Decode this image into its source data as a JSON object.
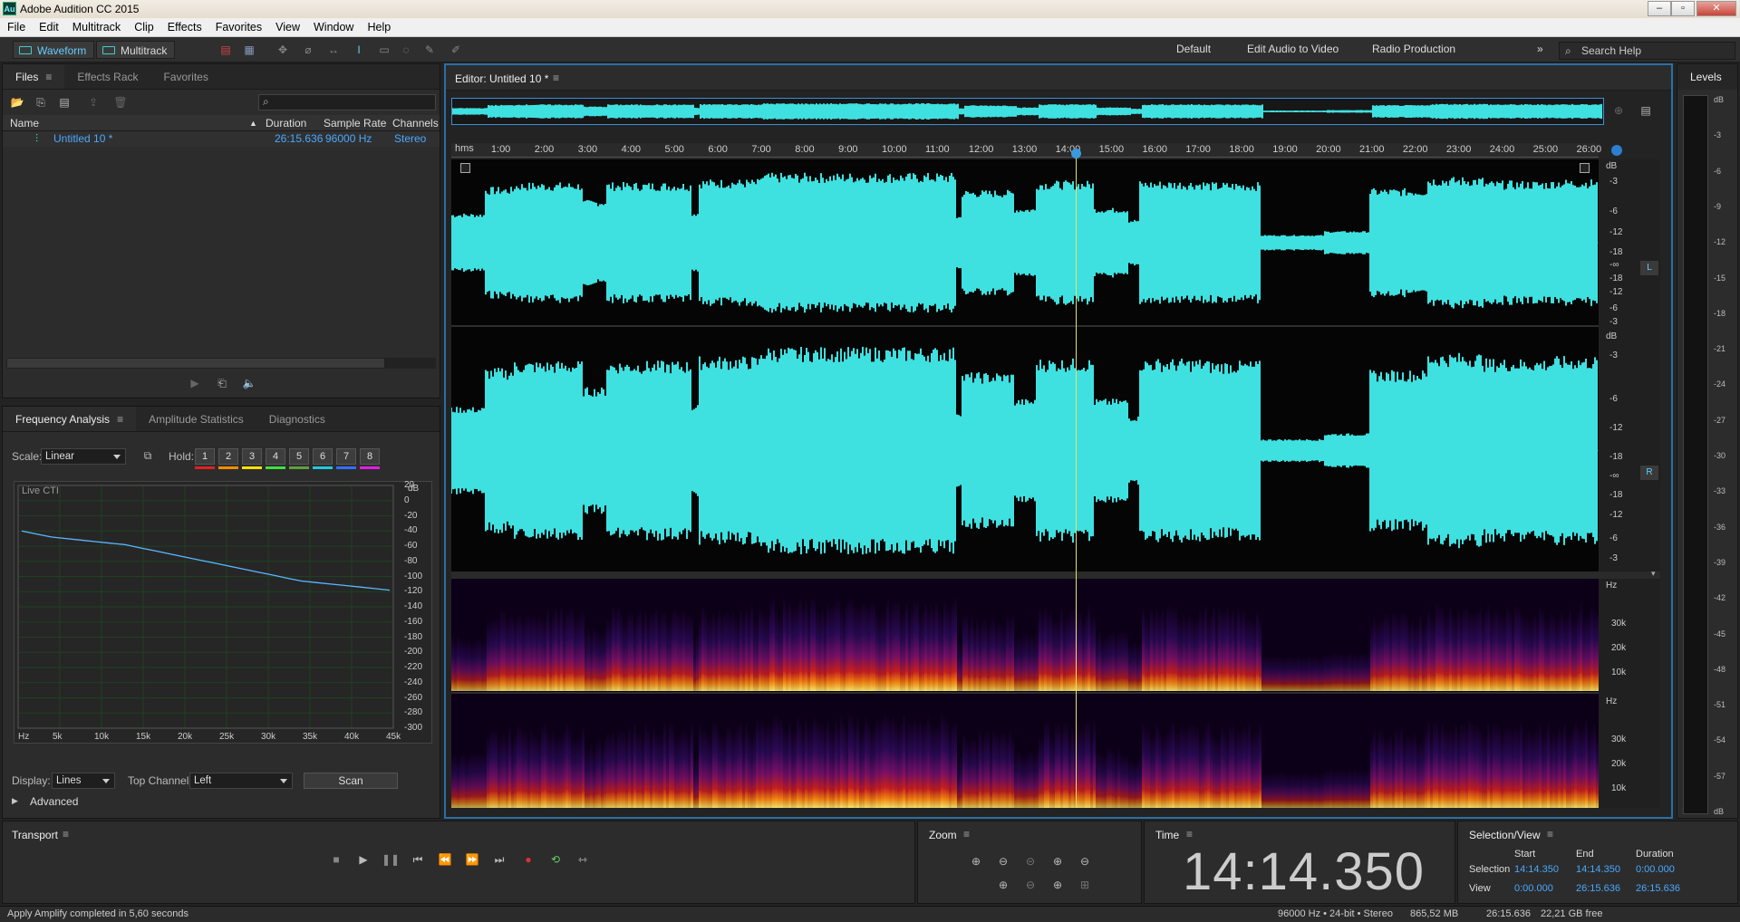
{
  "app": {
    "title": "Adobe Audition CC 2015",
    "icon": "Au"
  },
  "menu": [
    "File",
    "Edit",
    "Multitrack",
    "Clip",
    "Effects",
    "Favorites",
    "View",
    "Window",
    "Help"
  ],
  "toolbar": {
    "waveform": "Waveform",
    "multitrack": "Multitrack"
  },
  "workspaces": [
    "Default",
    "Edit Audio to Video",
    "Radio Production"
  ],
  "search": {
    "placeholder": "Search Help"
  },
  "files_panel": {
    "tabs": [
      "Files",
      "Effects Rack",
      "Favorites"
    ],
    "columns": [
      "Name",
      "Duration",
      "Sample Rate",
      "Channels"
    ],
    "rows": [
      {
        "name": "Untitled 10 *",
        "duration": "26:15.636",
        "sample_rate": "96000 Hz",
        "channels": "Stereo"
      }
    ]
  },
  "freq_panel": {
    "tabs": [
      "Frequency Analysis",
      "Amplitude Statistics",
      "Diagnostics"
    ],
    "scale_label": "Scale:",
    "scale_value": "Linear",
    "hold_label": "Hold:",
    "hold": [
      "1",
      "2",
      "3",
      "4",
      "5",
      "6",
      "7",
      "8"
    ],
    "hold_colors": [
      "#e02020",
      "#ff8c00",
      "#ffe000",
      "#40e040",
      "#60a040",
      "#20c8e0",
      "#3070ff",
      "#e020e0"
    ],
    "live": "Live CTI",
    "db_unit": "dB",
    "db_ticks": [
      "20",
      "0",
      "-20",
      "-40",
      "-60",
      "-80",
      "-100",
      "-120",
      "-140",
      "-160",
      "-180",
      "-200",
      "-220",
      "-240",
      "-260",
      "-280",
      "-300"
    ],
    "hz_ticks": [
      "Hz",
      "5k",
      "10k",
      "15k",
      "20k",
      "25k",
      "30k",
      "35k",
      "40k",
      "45k"
    ],
    "display_label": "Display:",
    "display_value": "Lines",
    "top_channel_label": "Top Channel:",
    "top_channel_value": "Left",
    "scan": "Scan",
    "advanced": "Advanced",
    "curve_db": [
      -40,
      -44,
      -48,
      -50,
      -52,
      -54,
      -56,
      -58,
      -62,
      -66,
      -70,
      -74,
      -78,
      -82,
      -86,
      -90,
      -94,
      -98,
      -102,
      -106,
      -108,
      -110,
      -112,
      -114,
      -116,
      -118
    ]
  },
  "editor": {
    "title": "Editor: Untitled 10 *",
    "ruler_unit": "hms",
    "ruler": [
      "1:00",
      "2:00",
      "3:00",
      "4:00",
      "5:00",
      "6:00",
      "7:00",
      "8:00",
      "9:00",
      "10:00",
      "11:00",
      "12:00",
      "13:00",
      "14:00",
      "15:00",
      "16:00",
      "17:00",
      "18:00",
      "19:00",
      "20:00",
      "21:00",
      "22:00",
      "23:00",
      "24:00",
      "25:00",
      "26:00"
    ],
    "db_unit": "dB",
    "db_ticks": [
      "-3",
      "-6",
      "-12",
      "-18",
      "-∞",
      "-18",
      "-12",
      "-6",
      "-3"
    ],
    "channels": [
      "L",
      "R"
    ],
    "hz_unit": "Hz",
    "hz_ticks": [
      "30k",
      "20k",
      "10k"
    ],
    "wave_color": "#3fe0e0",
    "playhead_color": "#e8e070"
  },
  "levels": {
    "title": "Levels",
    "ticks": [
      "dB",
      "-3",
      "-6",
      "-9",
      "-12",
      "-15",
      "-18",
      "-21",
      "-24",
      "-27",
      "-30",
      "-33",
      "-36",
      "-39",
      "-42",
      "-45",
      "-48",
      "-51",
      "-54",
      "-57",
      "dB"
    ]
  },
  "transport": {
    "title": "Transport"
  },
  "zoom": {
    "title": "Zoom"
  },
  "time": {
    "title": "Time",
    "value": "14:14.350"
  },
  "selview": {
    "title": "Selection/View",
    "cols": [
      "Start",
      "End",
      "Duration"
    ],
    "selection_label": "Selection",
    "view_label": "View",
    "selection": [
      "14:14.350",
      "14:14.350",
      "0:00.000"
    ],
    "view": [
      "0:00.000",
      "26:15.636",
      "26:15.636"
    ]
  },
  "status": {
    "left": "Apply Amplify completed in 5,60 seconds",
    "format": "96000 Hz • 24-bit • Stereo",
    "size": "865,52 MB",
    "duration": "26:15.636",
    "free": "22,21 GB free"
  }
}
